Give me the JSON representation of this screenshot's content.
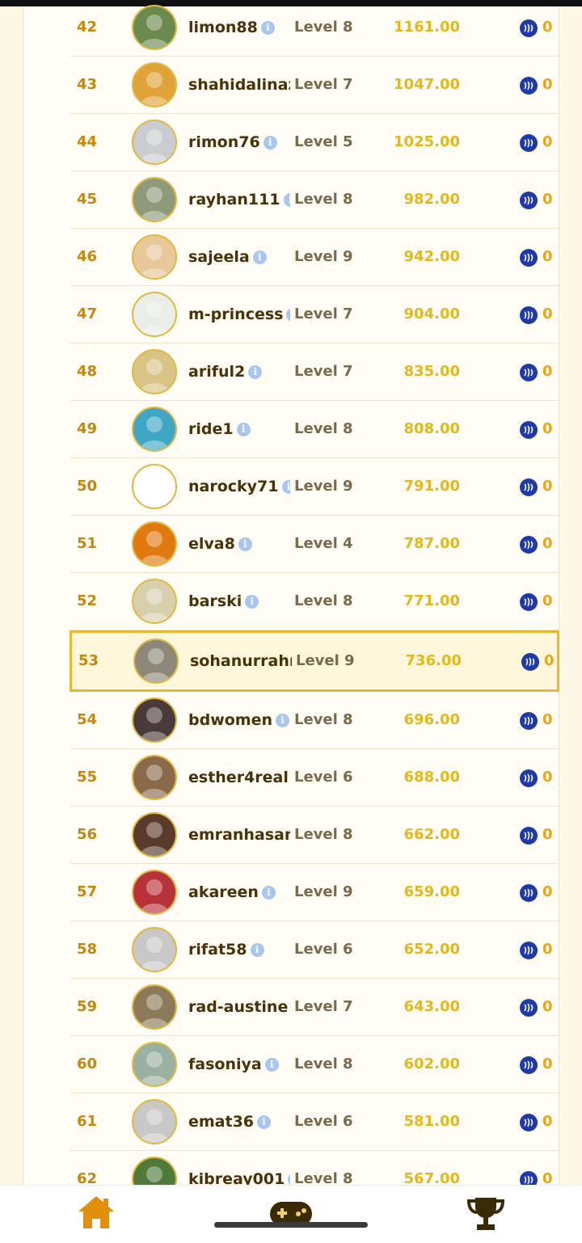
{
  "rows": [
    {
      "rank": "42",
      "name": "limon88",
      "level": "Level 8",
      "score": "1161.00",
      "reward": "0",
      "info": true,
      "current": false,
      "av": "#6b8a4e"
    },
    {
      "rank": "43",
      "name": "shahidalinaz",
      "level": "Level 7",
      "score": "1047.00",
      "reward": "0",
      "info": false,
      "current": false,
      "av": "#e0a33a"
    },
    {
      "rank": "44",
      "name": "rimon76",
      "level": "Level 5",
      "score": "1025.00",
      "reward": "0",
      "info": true,
      "current": false,
      "av": "#c9ccd0"
    },
    {
      "rank": "45",
      "name": "rayhan111",
      "level": "Level 8",
      "score": "982.00",
      "reward": "0",
      "info": true,
      "current": false,
      "av": "#8f9a7a"
    },
    {
      "rank": "46",
      "name": "sajeela",
      "level": "Level 9",
      "score": "942.00",
      "reward": "0",
      "info": true,
      "current": false,
      "av": "#e8c79a"
    },
    {
      "rank": "47",
      "name": "m-princess",
      "level": "Level 7",
      "score": "904.00",
      "reward": "0",
      "info": true,
      "current": false,
      "av": "#e9efe6"
    },
    {
      "rank": "48",
      "name": "ariful2",
      "level": "Level 7",
      "score": "835.00",
      "reward": "0",
      "info": true,
      "current": false,
      "av": "#d9c486"
    },
    {
      "rank": "49",
      "name": "ride1",
      "level": "Level 8",
      "score": "808.00",
      "reward": "0",
      "info": true,
      "current": false,
      "av": "#3fa6c4"
    },
    {
      "rank": "50",
      "name": "narocky71",
      "level": "Level 9",
      "score": "791.00",
      "reward": "0",
      "info": true,
      "current": false,
      "av": "#ffffff"
    },
    {
      "rank": "51",
      "name": "elva8",
      "level": "Level 4",
      "score": "787.00",
      "reward": "0",
      "info": true,
      "current": false,
      "av": "#e07a10"
    },
    {
      "rank": "52",
      "name": "barski",
      "level": "Level 8",
      "score": "771.00",
      "reward": "0",
      "info": true,
      "current": false,
      "av": "#d7cfae"
    },
    {
      "rank": "53",
      "name": "sohanurrahr",
      "level": "Level 9",
      "score": "736.00",
      "reward": "0",
      "info": false,
      "current": true,
      "av": "#8c8778"
    },
    {
      "rank": "54",
      "name": "bdwomen",
      "level": "Level 8",
      "score": "696.00",
      "reward": "0",
      "info": true,
      "current": false,
      "av": "#4a3a3a"
    },
    {
      "rank": "55",
      "name": "esther4real",
      "level": "Level 6",
      "score": "688.00",
      "reward": "0",
      "info": false,
      "current": false,
      "av": "#8a6a4a"
    },
    {
      "rank": "56",
      "name": "emranhasan",
      "level": "Level 8",
      "score": "662.00",
      "reward": "0",
      "info": false,
      "current": false,
      "av": "#5a3a2a"
    },
    {
      "rank": "57",
      "name": "akareen",
      "level": "Level 9",
      "score": "659.00",
      "reward": "0",
      "info": true,
      "current": false,
      "av": "#b8323a"
    },
    {
      "rank": "58",
      "name": "rifat58",
      "level": "Level 6",
      "score": "652.00",
      "reward": "0",
      "info": true,
      "current": false,
      "av": "#c8c8c8"
    },
    {
      "rank": "59",
      "name": "rad-austine",
      "level": "Level 7",
      "score": "643.00",
      "reward": "0",
      "info": false,
      "current": false,
      "av": "#8d7a5a"
    },
    {
      "rank": "60",
      "name": "fasoniya",
      "level": "Level 8",
      "score": "602.00",
      "reward": "0",
      "info": true,
      "current": false,
      "av": "#9ab0a0"
    },
    {
      "rank": "61",
      "name": "emat36",
      "level": "Level 6",
      "score": "581.00",
      "reward": "0",
      "info": true,
      "current": false,
      "av": "#c8c8c8"
    },
    {
      "rank": "62",
      "name": "kibreay001",
      "level": "Level 8",
      "score": "567.00",
      "reward": "0",
      "info": true,
      "current": false,
      "av": "#4f7a3a"
    }
  ],
  "info_glyph": "i",
  "nav": [
    {
      "icon": "home-icon",
      "color": "#e0900d"
    },
    {
      "icon": "gamepad-icon",
      "color": "#3a2a05"
    },
    {
      "icon": "trophy-icon",
      "color": "#3a2a05"
    }
  ]
}
